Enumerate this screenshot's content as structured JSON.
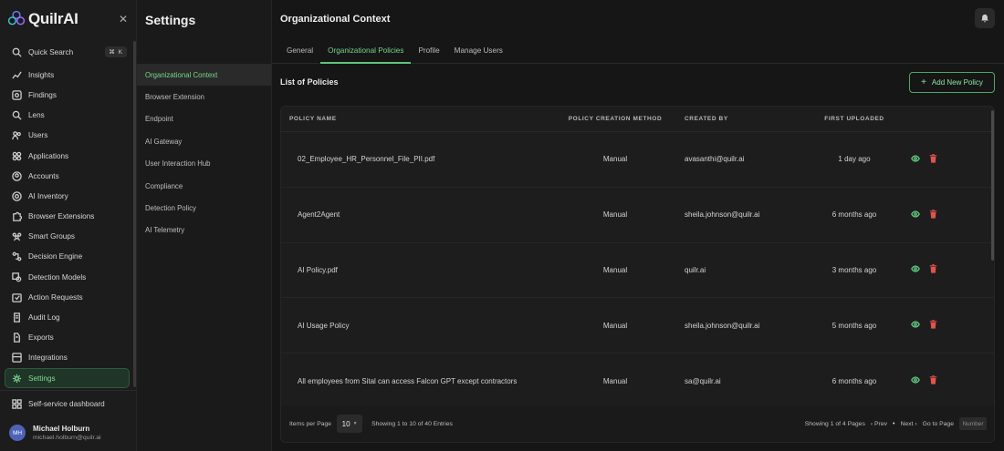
{
  "brand": {
    "name": "QuilrAI"
  },
  "nav": {
    "search": {
      "label": "Quick Search",
      "shortcut": "⌘ K"
    },
    "items": [
      {
        "label": "Insights",
        "icon": "chart-line-icon"
      },
      {
        "label": "Findings",
        "icon": "scan-icon"
      },
      {
        "label": "Lens",
        "icon": "lens-icon"
      },
      {
        "label": "Users",
        "icon": "users-icon"
      },
      {
        "label": "Applications",
        "icon": "applications-icon"
      },
      {
        "label": "Accounts",
        "icon": "account-icon"
      },
      {
        "label": "AI Inventory",
        "icon": "ai-inventory-icon"
      },
      {
        "label": "Browser Extensions",
        "icon": "puzzle-icon"
      },
      {
        "label": "Smart Groups",
        "icon": "groups-icon"
      },
      {
        "label": "Decision Engine",
        "icon": "decision-icon"
      },
      {
        "label": "Detection Models",
        "icon": "detection-icon"
      },
      {
        "label": "Action Requests",
        "icon": "action-icon"
      },
      {
        "label": "Audit Log",
        "icon": "audit-icon"
      },
      {
        "label": "Exports",
        "icon": "export-icon"
      },
      {
        "label": "Integrations",
        "icon": "integrations-icon"
      },
      {
        "label": "Settings",
        "icon": "gear-icon",
        "active": true
      }
    ],
    "self_service": "Self-service dashboard"
  },
  "user": {
    "initials": "MH",
    "name": "Michael Holburn",
    "email": "michael.holburn@quilr.ai"
  },
  "settings": {
    "title": "Settings",
    "items": [
      {
        "label": "Organizational Context",
        "active": true
      },
      {
        "label": "Browser Extension"
      },
      {
        "label": "Endpoint"
      },
      {
        "label": "AI Gateway"
      },
      {
        "label": "User Interaction Hub"
      },
      {
        "label": "Compliance"
      },
      {
        "label": "Detection Policy"
      },
      {
        "label": "AI Telemetry"
      }
    ]
  },
  "main": {
    "title": "Organizational Context",
    "tabs": [
      {
        "label": "General"
      },
      {
        "label": "Organizational Policies",
        "active": true
      },
      {
        "label": "Profile"
      },
      {
        "label": "Manage Users"
      }
    ],
    "list_title": "List of Policies",
    "add_button": "Add New Policy"
  },
  "table": {
    "columns": [
      "POLICY NAME",
      "POLICY CREATION METHOD",
      "CREATED BY",
      "FIRST UPLOADED"
    ],
    "rows": [
      {
        "name": "02_Employee_HR_Personnel_File_PII.pdf",
        "method": "Manual",
        "created_by": "avasanthi@quilr.ai",
        "uploaded": "1 day ago"
      },
      {
        "name": "Agent2Agent",
        "method": "Manual",
        "created_by": "sheila.johnson@quilr.ai",
        "uploaded": "6 months ago"
      },
      {
        "name": "AI Policy.pdf",
        "method": "Manual",
        "created_by": "quilr.ai",
        "uploaded": "3 months ago"
      },
      {
        "name": "AI Usage Policy",
        "method": "Manual",
        "created_by": "sheila.johnson@quilr.ai",
        "uploaded": "5 months ago"
      },
      {
        "name": "All employees from Sital can access Falcon GPT except contractors",
        "method": "Manual",
        "created_by": "sa@quilr.ai",
        "uploaded": "6 months ago"
      }
    ]
  },
  "footer": {
    "items_per_page_label": "Items per Page",
    "items_per_page_value": "10",
    "entries_text": "Showing 1 to 10 of 40 Entries",
    "page_text": "Showing 1 of 4 Pages",
    "prev": "‹ Prev",
    "next": "Next ›",
    "goto_label": "Go to Page",
    "goto_placeholder": "Number"
  },
  "colors": {
    "accent": "#5fc57a",
    "danger": "#e2524e",
    "background": "#161616"
  }
}
